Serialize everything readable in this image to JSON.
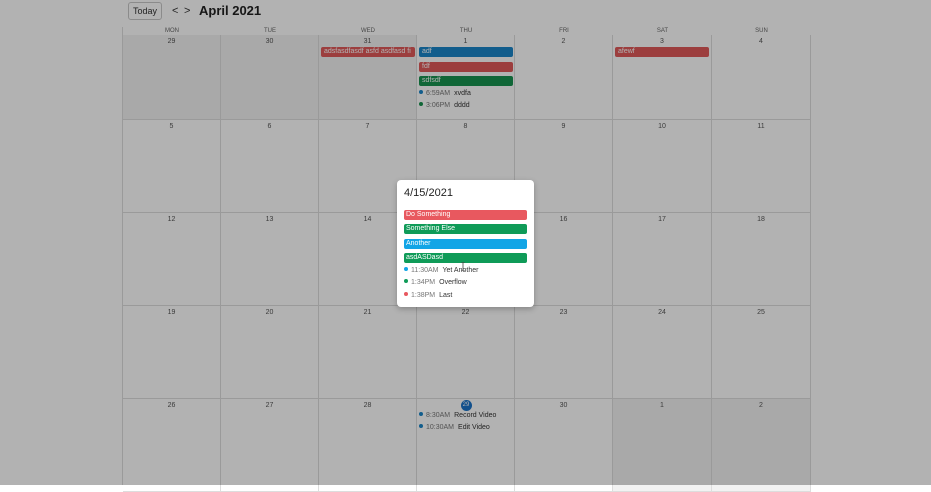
{
  "toolbar": {
    "today_label": "Today",
    "prev_label": "<",
    "next_label": ">",
    "title": "April 2021"
  },
  "weekdays": [
    "MON",
    "TUE",
    "WED",
    "THU",
    "FRI",
    "SAT",
    "SUN"
  ],
  "weeks": [
    {
      "days": [
        "29",
        "30",
        "31",
        "1",
        "2",
        "3",
        "4"
      ]
    },
    {
      "days": [
        "5",
        "6",
        "7",
        "8",
        "9",
        "10",
        "11"
      ]
    },
    {
      "days": [
        "12",
        "13",
        "14",
        "15",
        "16",
        "17",
        "18"
      ]
    },
    {
      "days": [
        "19",
        "20",
        "21",
        "22",
        "23",
        "24",
        "25"
      ]
    },
    {
      "days": [
        "26",
        "27",
        "28",
        "29",
        "30",
        "1",
        "2"
      ]
    }
  ],
  "events": {
    "wed31": {
      "title": "adsfasdfasdf asfd asdfasd fi",
      "color": "#e05a5a"
    },
    "thu1_bars": [
      {
        "title": "adf",
        "color": "#1a86c9"
      },
      {
        "title": "fdf",
        "color": "#e05a5a"
      },
      {
        "title": "sdfsdf",
        "color": "#18924f"
      }
    ],
    "thu1_dots": [
      {
        "time": "6:59AM",
        "title": "xvdfa",
        "color": "#1a86c9"
      },
      {
        "time": "3:06PM",
        "title": "dddd",
        "color": "#18924f"
      }
    ],
    "sat3": {
      "title": "afewf",
      "color": "#e05a5a"
    },
    "thu29_dots": [
      {
        "time": "8:30AM",
        "title": "Record Video",
        "color": "#1a86c9"
      },
      {
        "time": "10:30AM",
        "title": "Edit Video",
        "color": "#1a86c9"
      }
    ]
  },
  "popover": {
    "title": "4/15/2021",
    "bars": [
      {
        "title": "Do Something",
        "color": "#e8585f"
      },
      {
        "title": "Something Else",
        "color": "#0f9b58"
      },
      {
        "title": "Another",
        "color": "#12a5e6"
      },
      {
        "title": "asdASDasd",
        "color": "#0f9b58"
      }
    ],
    "dots": [
      {
        "time": "11:30AM",
        "title": "Yet Another",
        "color": "#12a5e6"
      },
      {
        "time": "1:34PM",
        "title": "Overflow",
        "color": "#0f9b58"
      },
      {
        "time": "1:38PM",
        "title": "Last",
        "color": "#e8585f"
      }
    ]
  }
}
